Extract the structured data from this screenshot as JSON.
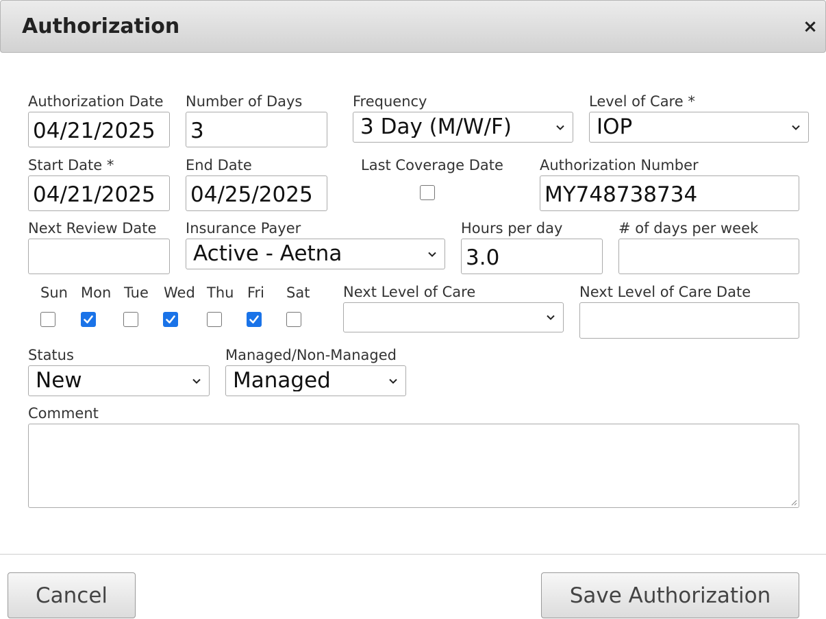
{
  "dialog": {
    "title": "Authorization",
    "close_glyph": "×",
    "close_icon": "close-icon"
  },
  "fields": {
    "authorization_date": {
      "label": "Authorization Date",
      "value": "04/21/2025"
    },
    "number_of_days": {
      "label": "Number of Days",
      "value": "3"
    },
    "frequency": {
      "label": "Frequency",
      "value": "3 Day (M/W/F)"
    },
    "level_of_care": {
      "label": "Level of Care *",
      "value": "IOP"
    },
    "start_date": {
      "label": "Start Date *",
      "value": "04/21/2025"
    },
    "end_date": {
      "label": "End Date",
      "value": "04/25/2025"
    },
    "last_coverage_date": {
      "label": "Last Coverage Date",
      "checked": false
    },
    "authorization_number": {
      "label": "Authorization Number",
      "value": "MY748738734"
    },
    "next_review_date": {
      "label": "Next Review Date",
      "value": ""
    },
    "insurance_payer": {
      "label": "Insurance Payer",
      "value": "Active - Aetna"
    },
    "hours_per_day": {
      "label": "Hours per day",
      "value": "3.0"
    },
    "days_per_week": {
      "label": "# of days per week",
      "value": ""
    },
    "next_level_of_care": {
      "label": "Next Level of Care",
      "value": ""
    },
    "next_level_of_care_date": {
      "label": "Next Level of Care Date",
      "value": ""
    },
    "status": {
      "label": "Status",
      "value": "New"
    },
    "managed": {
      "label": "Managed/Non-Managed",
      "value": "Managed"
    },
    "comment": {
      "label": "Comment",
      "value": ""
    }
  },
  "days": [
    {
      "label": "Sun",
      "checked": false
    },
    {
      "label": "Mon",
      "checked": true
    },
    {
      "label": "Tue",
      "checked": false
    },
    {
      "label": "Wed",
      "checked": true
    },
    {
      "label": "Thu",
      "checked": false
    },
    {
      "label": "Fri",
      "checked": true
    },
    {
      "label": "Sat",
      "checked": false
    }
  ],
  "buttons": {
    "cancel": "Cancel",
    "save": "Save Authorization"
  },
  "colors": {
    "checkbox_checked": "#1a73e8",
    "titlebar": "#dcdcdc"
  }
}
